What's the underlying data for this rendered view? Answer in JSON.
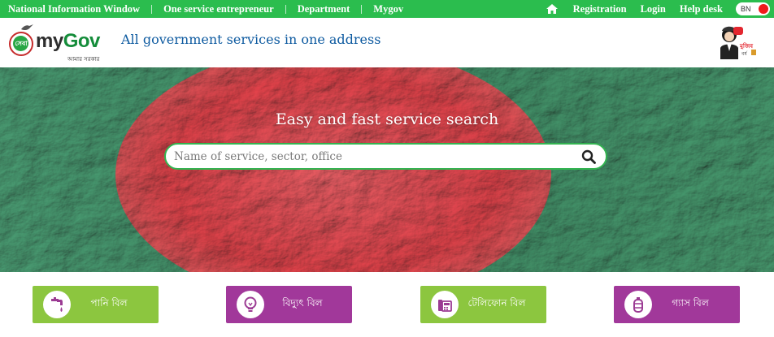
{
  "topbar": {
    "links": [
      "National Information Window",
      "One service entrepreneur",
      "Department",
      "Mygov"
    ],
    "right_links": [
      "Registration",
      "Login",
      "Help desk"
    ],
    "lang": "BN"
  },
  "header": {
    "brand_badge": "সেবা",
    "brand_my": "my",
    "brand_gov": "Gov",
    "brand_sub": "আমার সরকার",
    "tagline": "All government services in one address"
  },
  "hero": {
    "title": "Easy and fast service search",
    "search_placeholder": "Name of service, sector, office"
  },
  "bills": [
    {
      "label": "পানি বিল",
      "icon": "water-tap-icon",
      "color": "#8cc63f"
    },
    {
      "label": "বিদ্যুৎ বিল",
      "icon": "light-bulb-icon",
      "color": "#a1389a"
    },
    {
      "label": "টেলিফোন বিল",
      "icon": "telephone-icon",
      "color": "#8cc63f"
    },
    {
      "label": "গ্যাস বিল",
      "icon": "gas-cylinder-icon",
      "color": "#a1389a"
    }
  ],
  "colors": {
    "topbar": "#2bbd4e",
    "tagline": "#0d5aa0",
    "green_button": "#8cc63f",
    "purple_button": "#a1389a",
    "flag_red": "#d7262f",
    "flag_green": "#1f7a4d"
  }
}
